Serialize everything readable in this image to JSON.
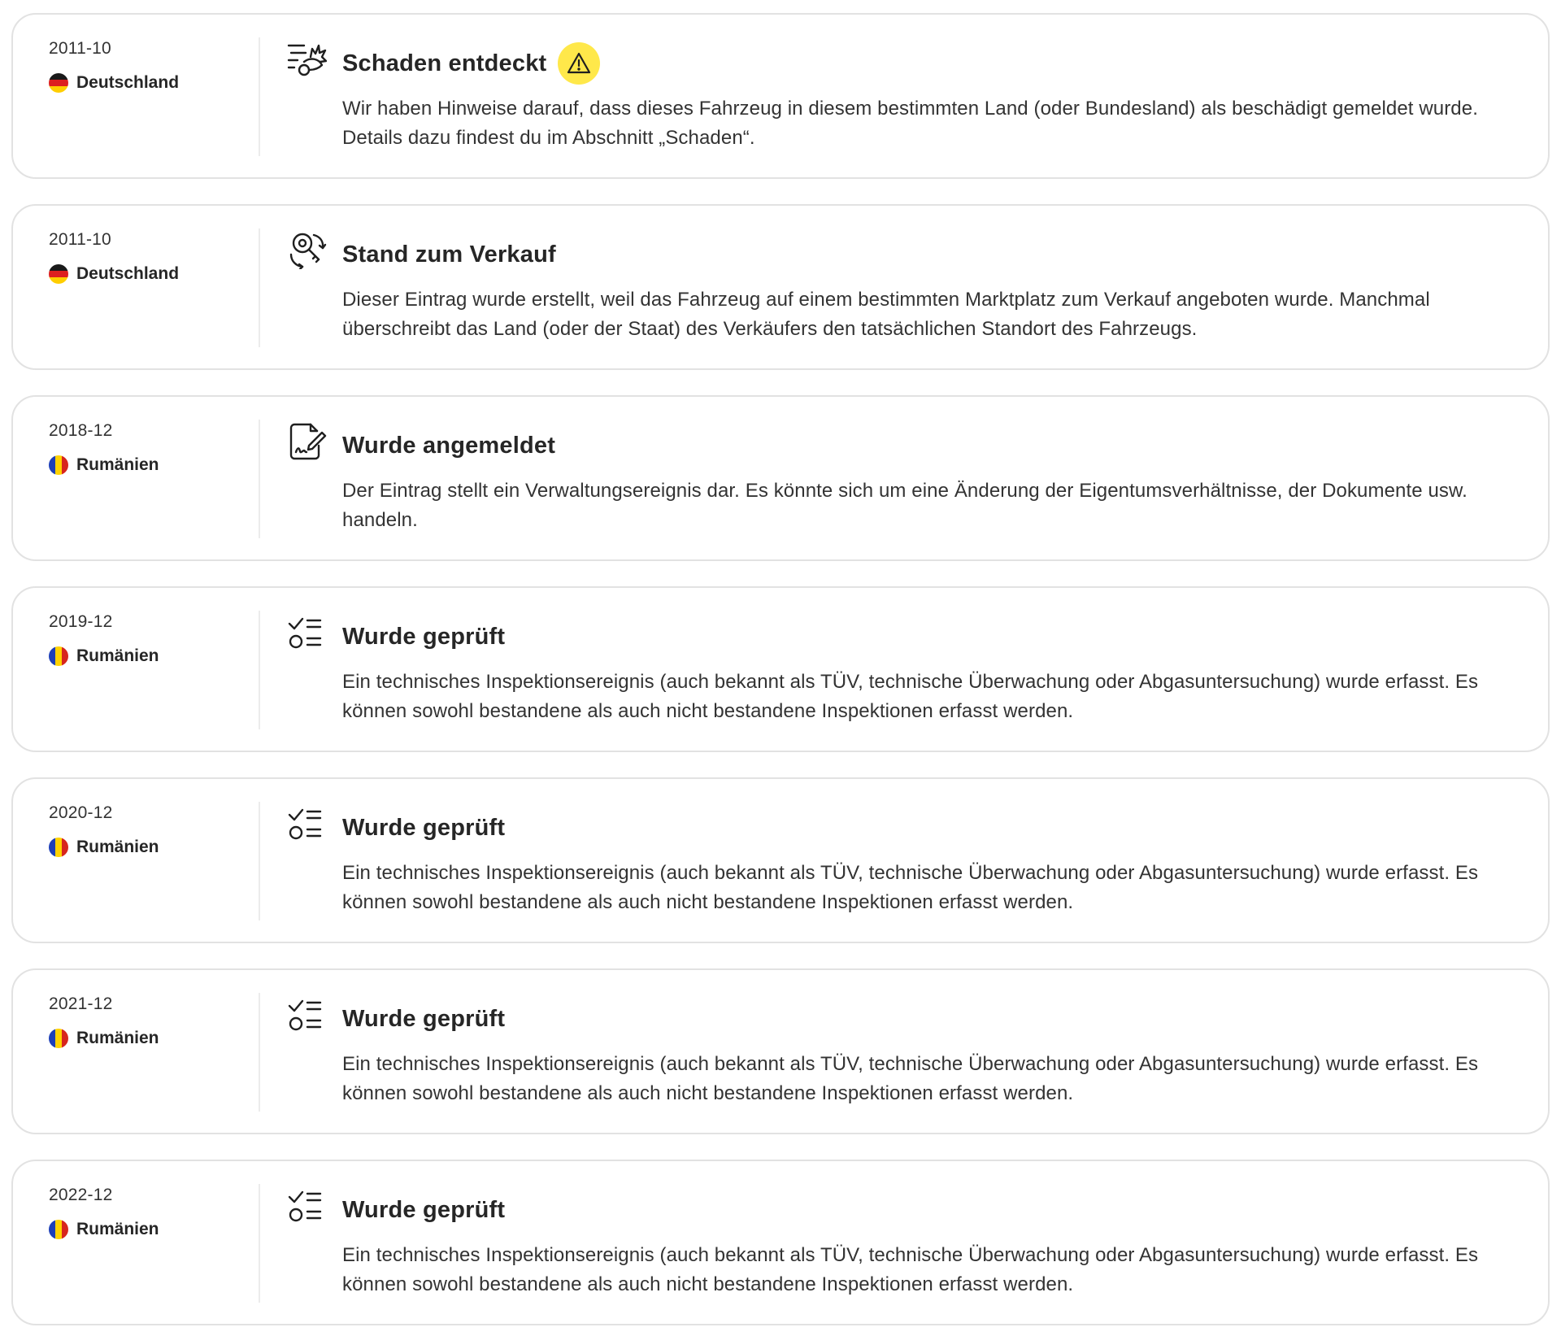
{
  "events": [
    {
      "date": "2011-10",
      "country": "Deutschland",
      "flag": "de",
      "icon": "damage-icon",
      "title": "Schaden entdeckt",
      "warning": true,
      "description": "Wir haben Hinweise darauf, dass dieses Fahrzeug in diesem bestimmten Land (oder Bundesland) als beschädigt gemeldet wurde. Details dazu findest du im Abschnitt „Schaden“."
    },
    {
      "date": "2011-10",
      "country": "Deutschland",
      "flag": "de",
      "icon": "for-sale-icon",
      "title": "Stand zum Verkauf",
      "warning": false,
      "description": "Dieser Eintrag wurde erstellt, weil das Fahrzeug auf einem bestimmten Marktplatz zum Verkauf angeboten wurde. Manchmal überschreibt das Land (oder der Staat) des Verkäufers den tatsächlichen Standort des Fahrzeugs."
    },
    {
      "date": "2018-12",
      "country": "Rumänien",
      "flag": "ro",
      "icon": "registration-document-icon",
      "title": "Wurde angemeldet",
      "warning": false,
      "description": "Der Eintrag stellt ein Verwaltungsereignis dar. Es könnte sich um eine Änderung der Eigentumsverhältnisse, der Dokumente usw. handeln."
    },
    {
      "date": "2019-12",
      "country": "Rumänien",
      "flag": "ro",
      "icon": "inspection-checklist-icon",
      "title": "Wurde geprüft",
      "warning": false,
      "description": "Ein technisches Inspektionsereignis (auch bekannt als TÜV, technische Überwachung oder Abgasuntersuchung) wurde erfasst. Es können sowohl bestandene als auch nicht bestandene Inspektionen erfasst werden."
    },
    {
      "date": "2020-12",
      "country": "Rumänien",
      "flag": "ro",
      "icon": "inspection-checklist-icon",
      "title": "Wurde geprüft",
      "warning": false,
      "description": "Ein technisches Inspektionsereignis (auch bekannt als TÜV, technische Überwachung oder Abgasuntersuchung) wurde erfasst. Es können sowohl bestandene als auch nicht bestandene Inspektionen erfasst werden."
    },
    {
      "date": "2021-12",
      "country": "Rumänien",
      "flag": "ro",
      "icon": "inspection-checklist-icon",
      "title": "Wurde geprüft",
      "warning": false,
      "description": "Ein technisches Inspektionsereignis (auch bekannt als TÜV, technische Überwachung oder Abgasuntersuchung) wurde erfasst. Es können sowohl bestandene als auch nicht bestandene Inspektionen erfasst werden."
    },
    {
      "date": "2022-12",
      "country": "Rumänien",
      "flag": "ro",
      "icon": "inspection-checklist-icon",
      "title": "Wurde geprüft",
      "warning": false,
      "description": "Ein technisches Inspektionsereignis (auch bekannt als TÜV, technische Überwachung oder Abgasuntersuchung) wurde erfasst. Es können sowohl bestandene als auch nicht bestandene Inspektionen erfasst werden."
    }
  ],
  "colors": {
    "warning_badge": "#ffe84a",
    "card_border": "#e2e2e2",
    "text": "#262626"
  }
}
